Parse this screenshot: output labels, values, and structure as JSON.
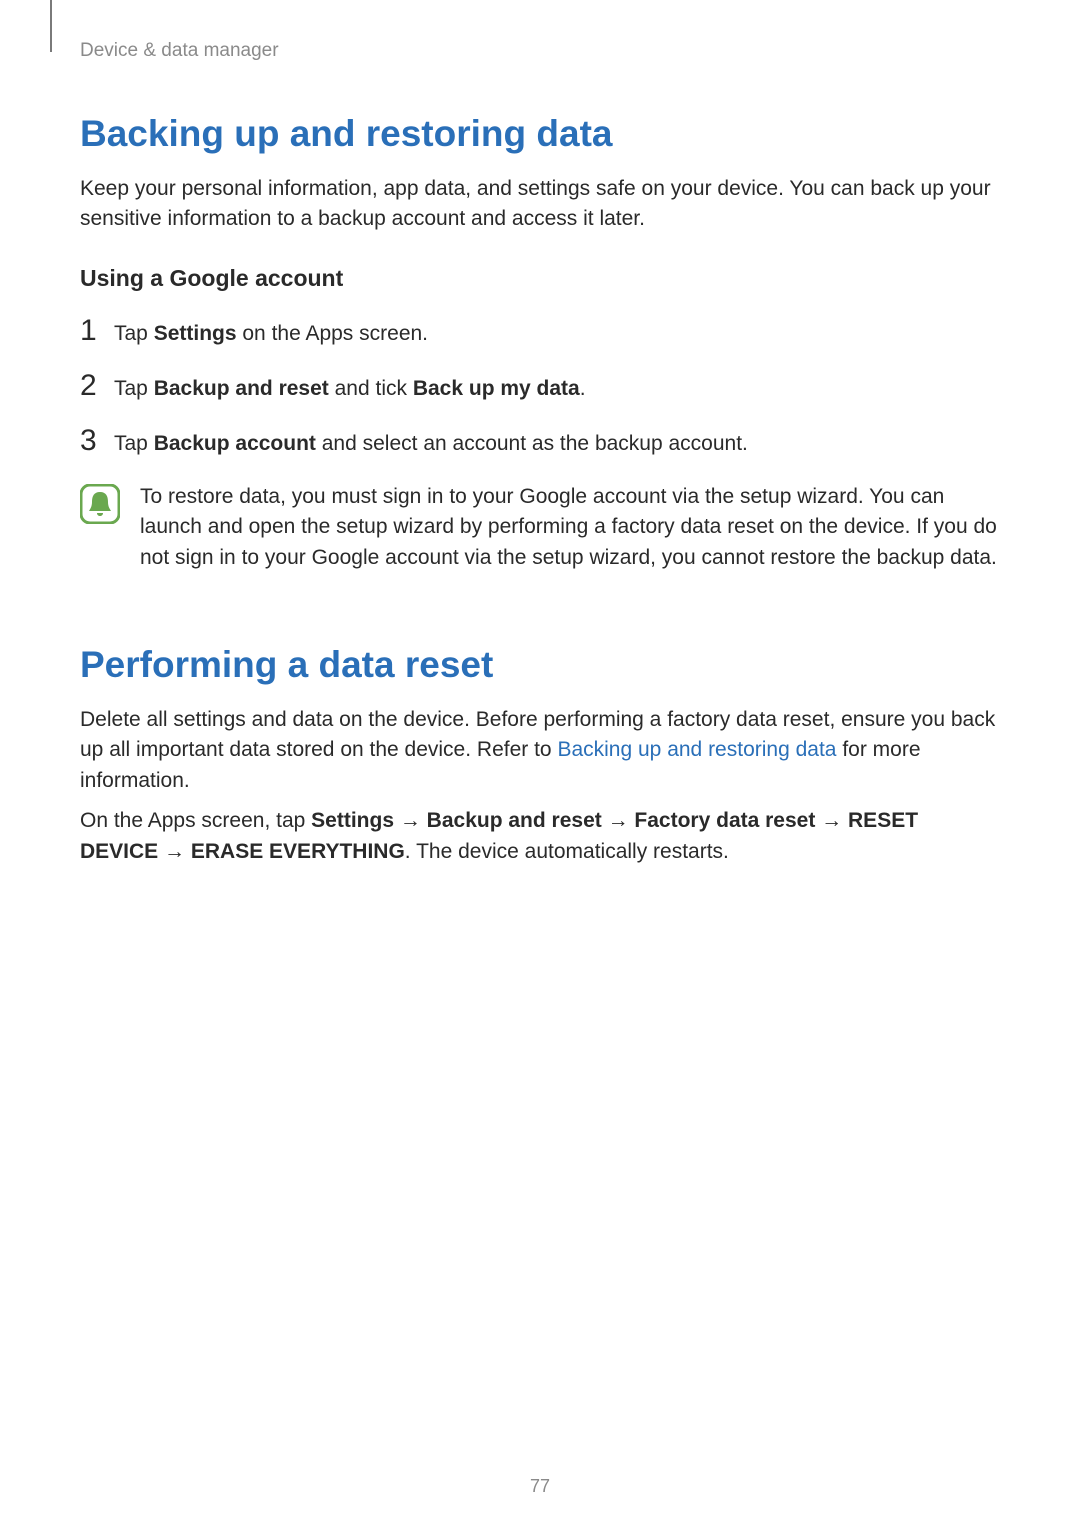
{
  "header": {
    "breadcrumb": "Device & data manager"
  },
  "section1": {
    "title": "Backing up and restoring data",
    "intro": "Keep your personal information, app data, and settings safe on your device. You can back up your sensitive information to a backup account and access it later.",
    "subhead": "Using a Google account",
    "steps": {
      "s1": {
        "num": "1",
        "pre": "Tap ",
        "b1": "Settings",
        "post": " on the Apps screen."
      },
      "s2": {
        "num": "2",
        "pre": "Tap ",
        "b1": "Backup and reset",
        "mid": " and tick ",
        "b2": "Back up my data",
        "post": "."
      },
      "s3": {
        "num": "3",
        "pre": "Tap ",
        "b1": "Backup account",
        "post": " and select an account as the backup account."
      }
    },
    "note": "To restore data, you must sign in to your Google account via the setup wizard. You can launch and open the setup wizard by performing a factory data reset on the device. If you do not sign in to your Google account via the setup wizard, you cannot restore the backup data."
  },
  "section2": {
    "title": "Performing a data reset",
    "p1": {
      "pre": "Delete all settings and data on the device. Before performing a factory data reset, ensure you back up all important data stored on the device. Refer to ",
      "link": "Backing up and restoring data",
      "post": " for more information."
    },
    "p2": {
      "pre": "On the Apps screen, tap ",
      "b1": "Settings",
      "a1": " → ",
      "b2": "Backup and reset",
      "a2": " → ",
      "b3": "Factory data reset",
      "a3": " → ",
      "b4": "RESET DEVICE",
      "a4": " → ",
      "b5": "ERASE EVERYTHING",
      "post": ". The device automatically restarts."
    }
  },
  "pagenum": "77",
  "colors": {
    "heading_blue": "#2a6fb8",
    "note_green": "#6aa84f"
  }
}
